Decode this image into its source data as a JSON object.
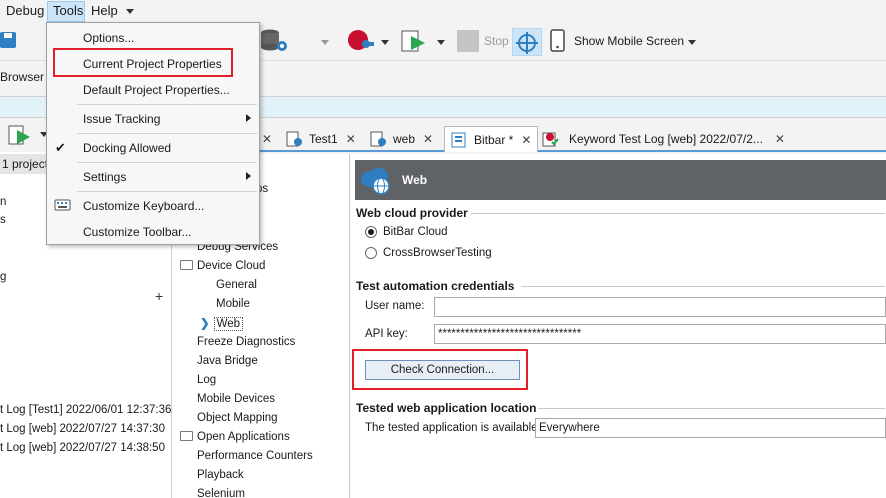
{
  "menubar": {
    "items": [
      {
        "label": "Debug",
        "accel": "D"
      },
      {
        "label": "Tools",
        "accel": "T"
      },
      {
        "label": "Help",
        "accel": "H"
      }
    ],
    "overflow_icon": "chevron-down-icon"
  },
  "toolbar": {
    "stop_label": "Stop",
    "show_mobile_label": "Show Mobile Screen",
    "icons": [
      "save-icon",
      "database-gear-icon",
      "record-icon",
      "run-icon",
      "stop-icon",
      "spy-icon",
      "mobile-icon"
    ]
  },
  "tools_menu": {
    "items": [
      {
        "label": "Options...",
        "has_submenu": false,
        "checked": false
      },
      {
        "label": "Current Project Properties",
        "has_submenu": false,
        "checked": false,
        "highlighted": true
      },
      {
        "label": "Default Project Properties...",
        "has_submenu": false,
        "checked": false
      },
      {
        "label": "Issue Tracking",
        "has_submenu": true,
        "checked": false
      },
      {
        "label": "Docking Allowed",
        "has_submenu": false,
        "checked": true
      },
      {
        "label": "Settings",
        "has_submenu": true,
        "checked": false
      },
      {
        "label": "Customize Keyboard...",
        "has_submenu": false,
        "checked": false
      },
      {
        "label": "Customize Toolbar...",
        "has_submenu": false,
        "checked": false
      }
    ]
  },
  "left_panel": {
    "browser_tab": "Browser",
    "project_label": "1 project)",
    "partial_items": [
      "n",
      "s",
      "g"
    ],
    "logs": [
      "t Log [Test1] 2022/06/01 12:37:36",
      "t Log [web] 2022/07/27 14:37:30",
      "t Log [web] 2022/07/27 14:38:50"
    ]
  },
  "tabs": [
    {
      "label": "Test1",
      "active": false
    },
    {
      "label": "web",
      "active": false
    },
    {
      "label": "Bitbar *",
      "active": true
    },
    {
      "label": "Keyword Test Log [web] 2022/07/2...",
      "active": false
    }
  ],
  "tree": {
    "items": [
      {
        "label": "ps",
        "partial": true
      },
      {
        "label": "Debug Services",
        "partial": true
      },
      {
        "label": "Device Cloud",
        "folder": true
      },
      {
        "label": "General",
        "indent": true
      },
      {
        "label": "Mobile",
        "indent": true
      },
      {
        "label": "Web",
        "indent": true,
        "selected": true
      },
      {
        "label": "Freeze Diagnostics"
      },
      {
        "label": "Java Bridge"
      },
      {
        "label": "Log"
      },
      {
        "label": "Mobile Devices"
      },
      {
        "label": "Object Mapping"
      },
      {
        "label": "Open Applications",
        "folder": true
      },
      {
        "label": "Performance Counters"
      },
      {
        "label": "Playback"
      },
      {
        "label": "Selenium"
      }
    ]
  },
  "properties": {
    "header": "Web",
    "cloud_provider_title": "Web cloud provider",
    "providers": [
      {
        "label": "BitBar Cloud",
        "selected": true
      },
      {
        "label": "CrossBrowserTesting",
        "selected": false
      }
    ],
    "credentials_title": "Test automation credentials",
    "username_label": "User name:",
    "username_value": "",
    "apikey_label": "API key:",
    "apikey_value": "********************************",
    "check_button": "Check Connection...",
    "location_title": "Tested web application location",
    "location_label": "The tested application is available:",
    "location_value": "Everywhere"
  },
  "colors": {
    "highlight_red": "#e0202a",
    "accent_blue": "#5b9bd5",
    "header_gray": "#5f6368"
  }
}
